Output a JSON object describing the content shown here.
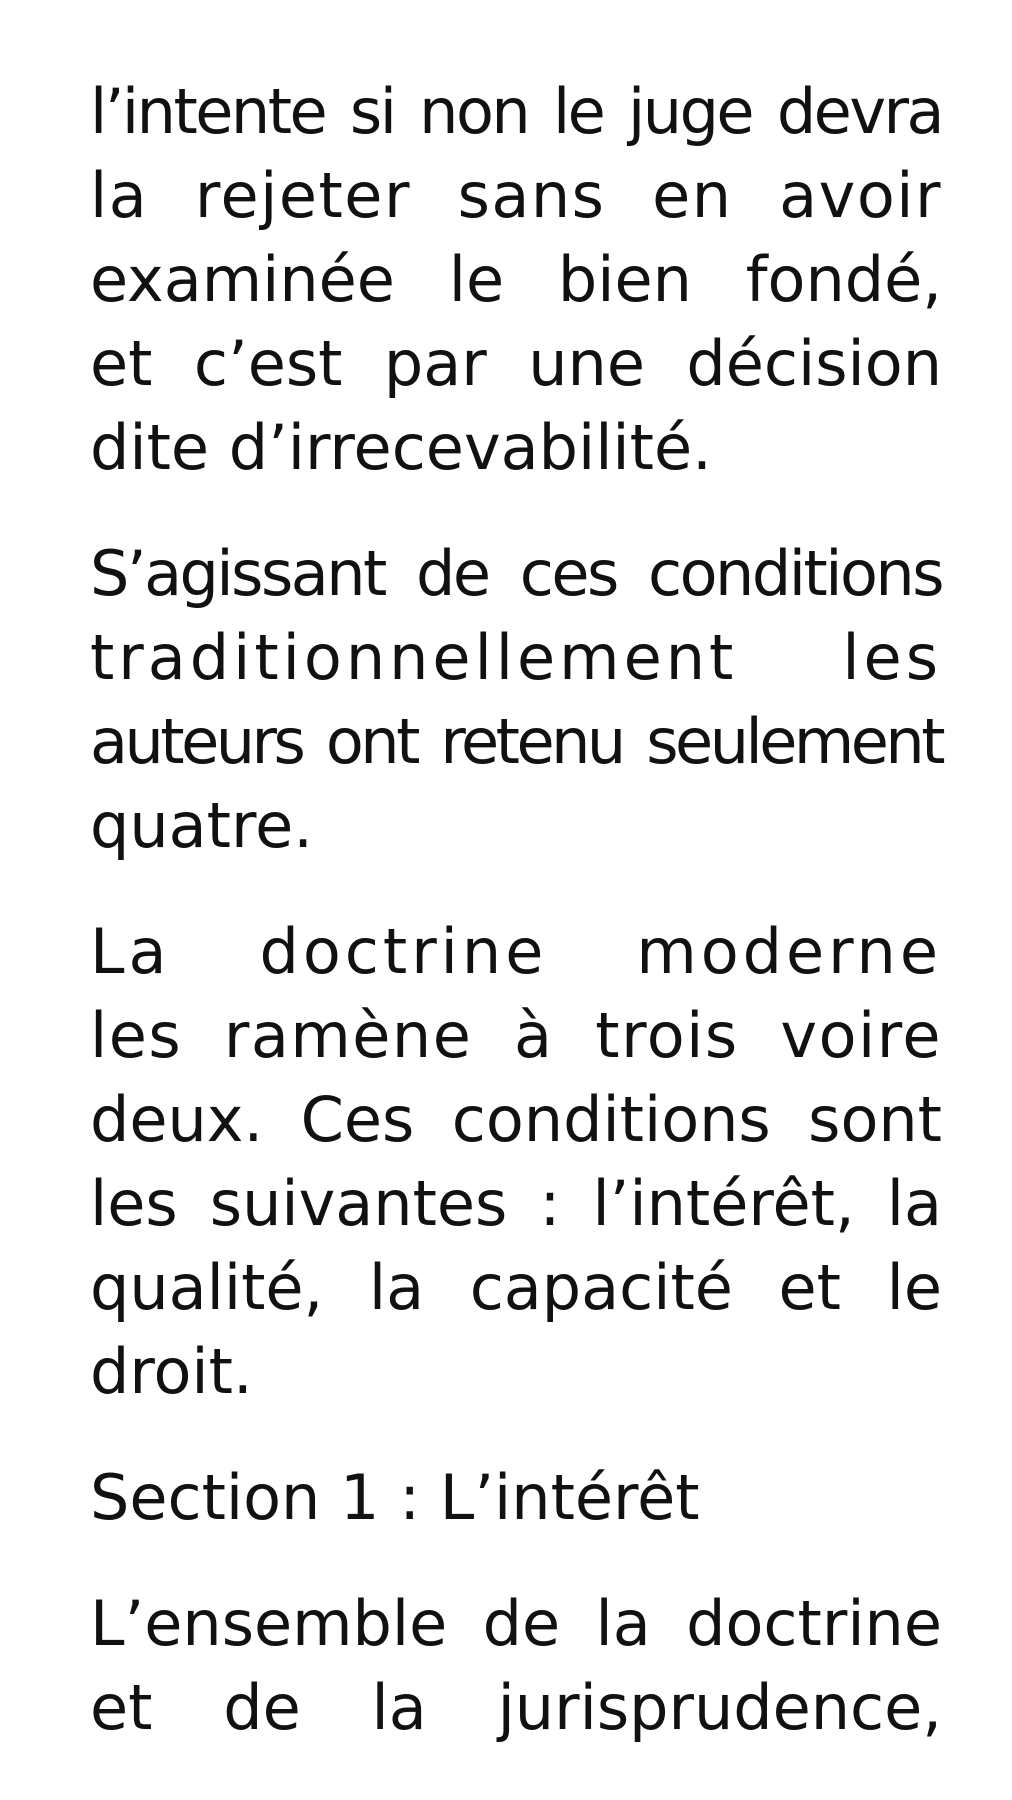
{
  "document": {
    "paragraph_1": {
      "lines": [
        "l’intente si non le juge devra",
        "la rejeter sans en avoir",
        "examinée le bien fondé,",
        "et c’est par une décision",
        "dite d’irrecevabilité."
      ]
    },
    "paragraph_2": {
      "lines": [
        "S’agissant de ces conditions",
        "traditionnellement les",
        "auteurs ont retenu seulement",
        "quatre."
      ]
    },
    "paragraph_3": {
      "lines": [
        "La doctrine moderne",
        "les ramène à trois voire",
        "deux. Ces conditions sont",
        "les suivantes : l’intérêt, la",
        "qualité, la capacité et le",
        "droit."
      ]
    },
    "section_heading": "Section 1 : L’intérêt",
    "paragraph_4": {
      "lines": [
        "L’ensemble de la doctrine",
        "et de la jurisprudence,"
      ]
    }
  }
}
